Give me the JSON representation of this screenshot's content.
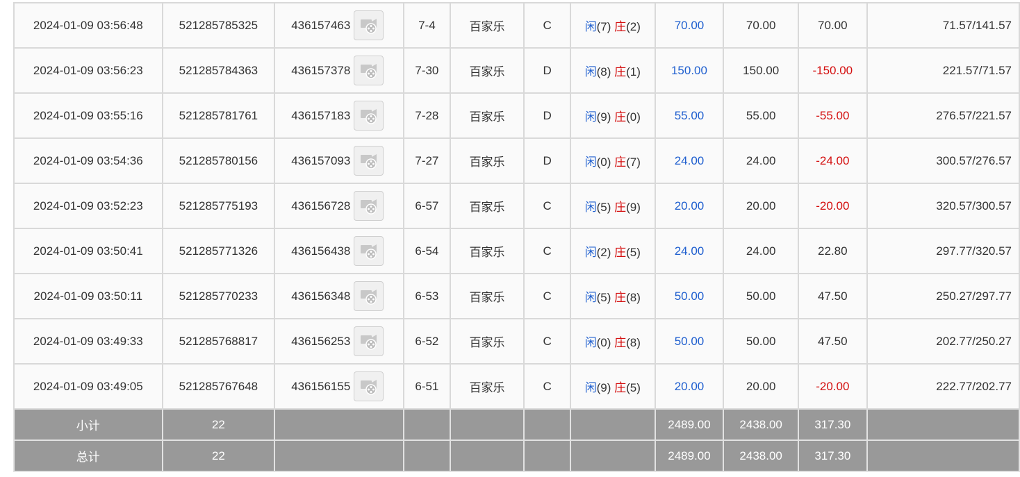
{
  "rows": [
    {
      "time": "2024-01-09 03:56:48",
      "bet_id": "521285785325",
      "round_id": "436157463",
      "shoe": "7-4",
      "game": "百家乐",
      "table": "C",
      "player_label": "闲",
      "player_score": "(7)",
      "banker_label": "庄",
      "banker_score": "(2)",
      "bet": "70.00",
      "valid": "70.00",
      "winloss": "70.00",
      "winloss_negative": false,
      "balance": "71.57/141.57"
    },
    {
      "time": "2024-01-09 03:56:23",
      "bet_id": "521285784363",
      "round_id": "436157378",
      "shoe": "7-30",
      "game": "百家乐",
      "table": "D",
      "player_label": "闲",
      "player_score": "(8)",
      "banker_label": "庄",
      "banker_score": "(1)",
      "bet": "150.00",
      "valid": "150.00",
      "winloss": "-150.00",
      "winloss_negative": true,
      "balance": "221.57/71.57"
    },
    {
      "time": "2024-01-09 03:55:16",
      "bet_id": "521285781761",
      "round_id": "436157183",
      "shoe": "7-28",
      "game": "百家乐",
      "table": "D",
      "player_label": "闲",
      "player_score": "(9)",
      "banker_label": "庄",
      "banker_score": "(0)",
      "bet": "55.00",
      "valid": "55.00",
      "winloss": "-55.00",
      "winloss_negative": true,
      "balance": "276.57/221.57"
    },
    {
      "time": "2024-01-09 03:54:36",
      "bet_id": "521285780156",
      "round_id": "436157093",
      "shoe": "7-27",
      "game": "百家乐",
      "table": "D",
      "player_label": "闲",
      "player_score": "(0)",
      "banker_label": "庄",
      "banker_score": "(7)",
      "bet": "24.00",
      "valid": "24.00",
      "winloss": "-24.00",
      "winloss_negative": true,
      "balance": "300.57/276.57"
    },
    {
      "time": "2024-01-09 03:52:23",
      "bet_id": "521285775193",
      "round_id": "436156728",
      "shoe": "6-57",
      "game": "百家乐",
      "table": "C",
      "player_label": "闲",
      "player_score": "(5)",
      "banker_label": "庄",
      "banker_score": "(9)",
      "bet": "20.00",
      "valid": "20.00",
      "winloss": "-20.00",
      "winloss_negative": true,
      "balance": "320.57/300.57"
    },
    {
      "time": "2024-01-09 03:50:41",
      "bet_id": "521285771326",
      "round_id": "436156438",
      "shoe": "6-54",
      "game": "百家乐",
      "table": "C",
      "player_label": "闲",
      "player_score": "(2)",
      "banker_label": "庄",
      "banker_score": "(5)",
      "bet": "24.00",
      "valid": "24.00",
      "winloss": "22.80",
      "winloss_negative": false,
      "balance": "297.77/320.57"
    },
    {
      "time": "2024-01-09 03:50:11",
      "bet_id": "521285770233",
      "round_id": "436156348",
      "shoe": "6-53",
      "game": "百家乐",
      "table": "C",
      "player_label": "闲",
      "player_score": "(5)",
      "banker_label": "庄",
      "banker_score": "(8)",
      "bet": "50.00",
      "valid": "50.00",
      "winloss": "47.50",
      "winloss_negative": false,
      "balance": "250.27/297.77"
    },
    {
      "time": "2024-01-09 03:49:33",
      "bet_id": "521285768817",
      "round_id": "436156253",
      "shoe": "6-52",
      "game": "百家乐",
      "table": "C",
      "player_label": "闲",
      "player_score": "(0)",
      "banker_label": "庄",
      "banker_score": "(8)",
      "bet": "50.00",
      "valid": "50.00",
      "winloss": "47.50",
      "winloss_negative": false,
      "balance": "202.77/250.27"
    },
    {
      "time": "2024-01-09 03:49:05",
      "bet_id": "521285767648",
      "round_id": "436156155",
      "shoe": "6-51",
      "game": "百家乐",
      "table": "C",
      "player_label": "闲",
      "player_score": "(9)",
      "banker_label": "庄",
      "banker_score": "(5)",
      "bet": "20.00",
      "valid": "20.00",
      "winloss": "-20.00",
      "winloss_negative": true,
      "balance": "222.77/202.77"
    }
  ],
  "subtotal": {
    "label": "小计",
    "count": "22",
    "bet": "2489.00",
    "valid": "2438.00",
    "winloss": "317.30"
  },
  "total": {
    "label": "总计",
    "count": "22",
    "bet": "2489.00",
    "valid": "2438.00",
    "winloss": "317.30"
  },
  "icons": {
    "replay": "video-replay-icon"
  },
  "colors": {
    "player": "#1f5fcf",
    "banker": "#d40f0f",
    "bet_amount": "#1f5fcf",
    "negative": "#d40f0f",
    "summary_bg": "#999999"
  }
}
